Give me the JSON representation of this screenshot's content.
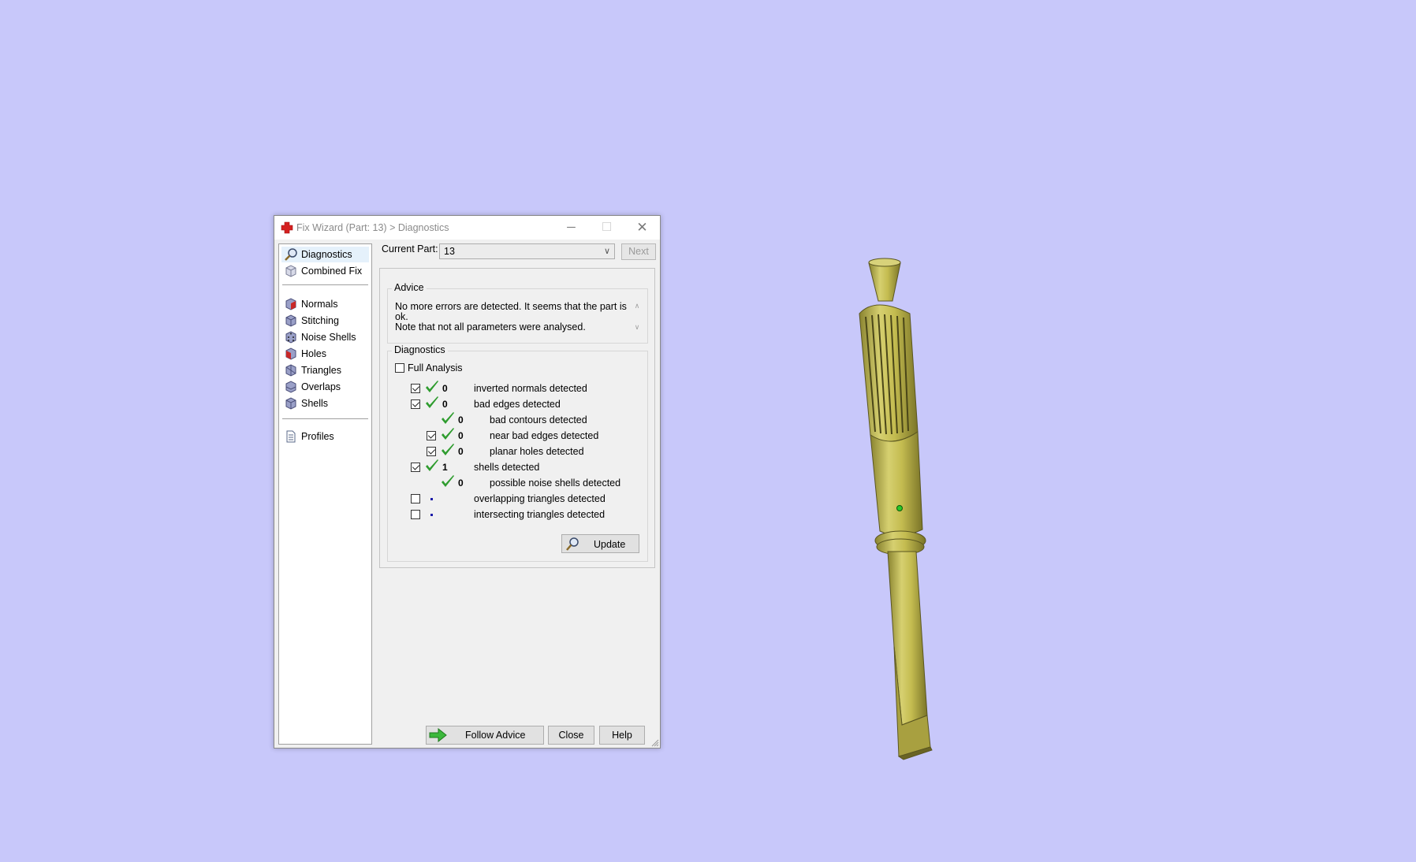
{
  "window": {
    "title": "Fix Wizard (Part: 13) > Diagnostics",
    "minimize_glyph": "─",
    "maximize_glyph": "☐",
    "close_glyph": "✕"
  },
  "sidebar": {
    "items": [
      {
        "label": "Diagnostics",
        "icon": "magnifier-icon",
        "selected": true
      },
      {
        "label": "Combined Fix",
        "icon": "cube-icon"
      },
      {
        "label": "Normals",
        "icon": "cube-red-face-icon"
      },
      {
        "label": "Stitching",
        "icon": "cube-stitch-icon"
      },
      {
        "label": "Noise Shells",
        "icon": "dice-icon"
      },
      {
        "label": "Holes",
        "icon": "cube-hole-icon"
      },
      {
        "label": "Triangles",
        "icon": "triangle-cube-icon"
      },
      {
        "label": "Overlaps",
        "icon": "overlap-cube-icon"
      },
      {
        "label": "Shells",
        "icon": "shells-cube-icon"
      },
      {
        "label": "Profiles",
        "icon": "document-icon"
      }
    ]
  },
  "current_part": {
    "label": "Current Part:",
    "value": "13",
    "next_label": "Next"
  },
  "advice": {
    "group_label": "Advice",
    "line1": "No more errors are detected. It seems that the part is ok.",
    "line2": "Note that not all parameters were analysed."
  },
  "diagnostics": {
    "group_label": "Diagnostics",
    "full_analysis_label": "Full Analysis",
    "full_analysis_checked": false,
    "rows": [
      {
        "checkbox": true,
        "checked": true,
        "status": "ok",
        "count": "0",
        "label": "inverted normals detected",
        "indent": 0
      },
      {
        "checkbox": true,
        "checked": true,
        "status": "ok",
        "count": "0",
        "label": "bad edges detected",
        "indent": 0
      },
      {
        "checkbox": false,
        "checked": false,
        "status": "ok",
        "count": "0",
        "label": "bad contours detected",
        "indent": 1
      },
      {
        "checkbox": true,
        "checked": true,
        "status": "ok",
        "count": "0",
        "label": "near bad edges detected",
        "indent": 1
      },
      {
        "checkbox": true,
        "checked": true,
        "status": "ok",
        "count": "0",
        "label": "planar holes detected",
        "indent": 1
      },
      {
        "checkbox": true,
        "checked": true,
        "status": "ok",
        "count": "1",
        "label": "shells detected",
        "indent": 0
      },
      {
        "checkbox": false,
        "checked": false,
        "status": "ok",
        "count": "0",
        "label": "possible noise shells detected",
        "indent": 1
      },
      {
        "checkbox": true,
        "checked": false,
        "status": "none",
        "count": "",
        "label": "overlapping triangles detected",
        "indent": 0
      },
      {
        "checkbox": true,
        "checked": false,
        "status": "none",
        "count": "",
        "label": "intersecting triangles detected",
        "indent": 0
      }
    ],
    "update_label": "Update"
  },
  "buttons": {
    "follow_advice": "Follow Advice",
    "close": "Close",
    "help": "Help"
  },
  "colors": {
    "desktop_bg": "#c8c8fa",
    "check_green": "#2e9c2e",
    "model_yellow": "#c8c050"
  }
}
